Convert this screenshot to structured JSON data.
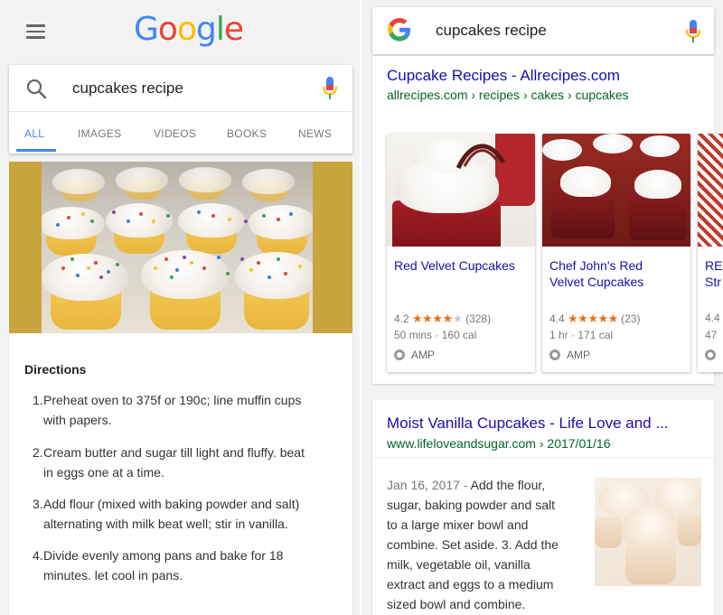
{
  "left": {
    "logo": [
      "G",
      "o",
      "o",
      "g",
      "l",
      "e"
    ],
    "logo_colors": [
      "#4285f4",
      "#ea4335",
      "#fbbc05",
      "#4285f4",
      "#34a853",
      "#ea4335"
    ],
    "search": {
      "query": "cupcakes recipe"
    },
    "tabs": [
      "ALL",
      "IMAGES",
      "VIDEOS",
      "BOOKS",
      "NEWS"
    ],
    "active_tab": "ALL",
    "directions": {
      "title": "Directions",
      "steps": [
        {
          "num": "1.",
          "line1": "Preheat oven to 375f or 190c; line muffin cups",
          "line2": "with papers."
        },
        {
          "num": "2.",
          "line1": "Cream butter and sugar till light and fluffy. beat",
          "line2": "in eggs one at a time."
        },
        {
          "num": "3.",
          "line1": "Add flour (mixed with baking powder and salt)",
          "line2": "alternating with milk beat well; stir in vanilla."
        },
        {
          "num": "4.",
          "line1": "Divide evenly among pans and bake for 18",
          "line2": "minutes. let cool in pans."
        }
      ]
    }
  },
  "right": {
    "search": {
      "query": "cupcakes recipe"
    },
    "result1": {
      "title": "Cupcake Recipes - Allrecipes.com",
      "url": "allrecipes.com › recipes › cakes › cupcakes",
      "cards": [
        {
          "title_line1": "Red Velvet Cupcakes",
          "title_line2": "",
          "rating": "4.2",
          "stars_full": "★★★★",
          "stars_empty": "★",
          "reviews": "(328)",
          "meta": "50 mins · 160 cal",
          "amp": "AMP"
        },
        {
          "title_line1": "Chef John's Red",
          "title_line2": "Velvet Cupcakes",
          "rating": "4.4",
          "stars_full": "★★★★★",
          "stars_empty": "",
          "reviews": "(23)",
          "meta": "1 hr · 171 cal",
          "amp": "AMP"
        },
        {
          "title_line1": "RE",
          "title_line2": "Str",
          "rating": "4.4",
          "stars_full": "",
          "stars_empty": "",
          "reviews": "",
          "meta": "47",
          "amp": ""
        }
      ]
    },
    "result2": {
      "title": "Moist Vanilla Cupcakes - Life Love and ...",
      "url": "www.lifeloveandsugar.com › 2017/01/16",
      "date": "Jan 16, 2017 -",
      "snippet_lines": [
        "Add the flour,",
        "sugar, baking powder and salt",
        "to a large mixer bowl and",
        "combine. Set aside. 3. Add the",
        "milk, vegetable oil, vanilla",
        "extract and eggs to a medium",
        "sized bowl and combine."
      ]
    }
  },
  "colors": {
    "link": "#1a0dab",
    "url_green": "#006621",
    "accent_blue": "#4285f4",
    "star_orange": "#e7711b"
  }
}
